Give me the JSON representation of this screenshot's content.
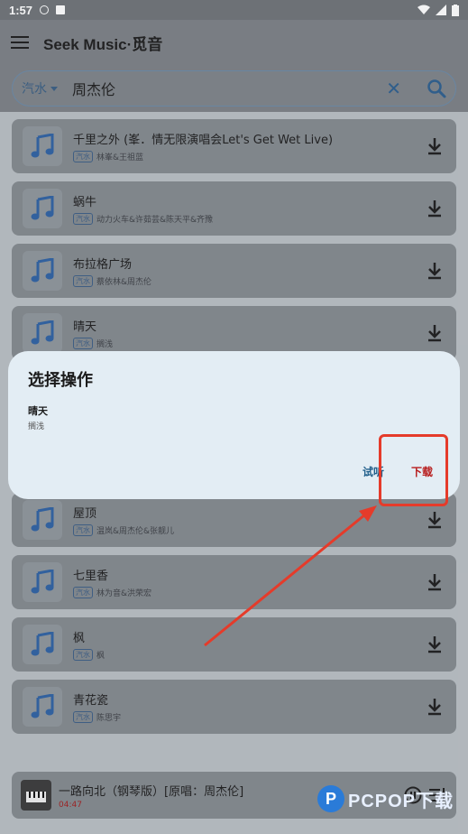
{
  "status_bar": {
    "time": "1:57"
  },
  "app_bar": {
    "title": "Seek Music·觅音"
  },
  "search": {
    "source": "汽水",
    "query": "周杰伦"
  },
  "songs": [
    {
      "title": "千里之外 (峯．情无限演唱会Let's Get Wet Live)",
      "tag": "汽水",
      "artist": "林峯&王祖蓝"
    },
    {
      "title": "蜗牛",
      "tag": "汽水",
      "artist": "动力火车&许茹芸&陈天平&齐豫"
    },
    {
      "title": "布拉格广场",
      "tag": "汽水",
      "artist": "蔡依林&周杰伦"
    },
    {
      "title": "晴天",
      "tag": "汽水",
      "artist": "搁浅"
    },
    {
      "title": "屋顶",
      "tag": "汽水",
      "artist": "温岚&周杰伦&张靓儿"
    },
    {
      "title": "七里香",
      "tag": "汽水",
      "artist": "林为音&洪荣宏"
    },
    {
      "title": "枫",
      "tag": "汽水",
      "artist": "枫"
    },
    {
      "title": "青花瓷",
      "tag": "汽水",
      "artist": "陈思宇"
    },
    {
      "title": "一路向北（钢琴版）[原唱：周杰伦]",
      "tag": "",
      "artist": ""
    }
  ],
  "player": {
    "title": "一路向北（钢琴版）[原唱：周杰伦]",
    "time": "04:47"
  },
  "dialog": {
    "title": "选择操作",
    "song": "晴天",
    "artist": "搁浅",
    "listen_label": "试听",
    "download_label": "下载"
  },
  "watermark": {
    "brand": "PCPOP下载",
    "logo_letter": "P",
    "sub": ""
  },
  "colors": {
    "accent": "#1f5e8a",
    "highlight": "#e53b2a",
    "download": "#b71b1b"
  }
}
